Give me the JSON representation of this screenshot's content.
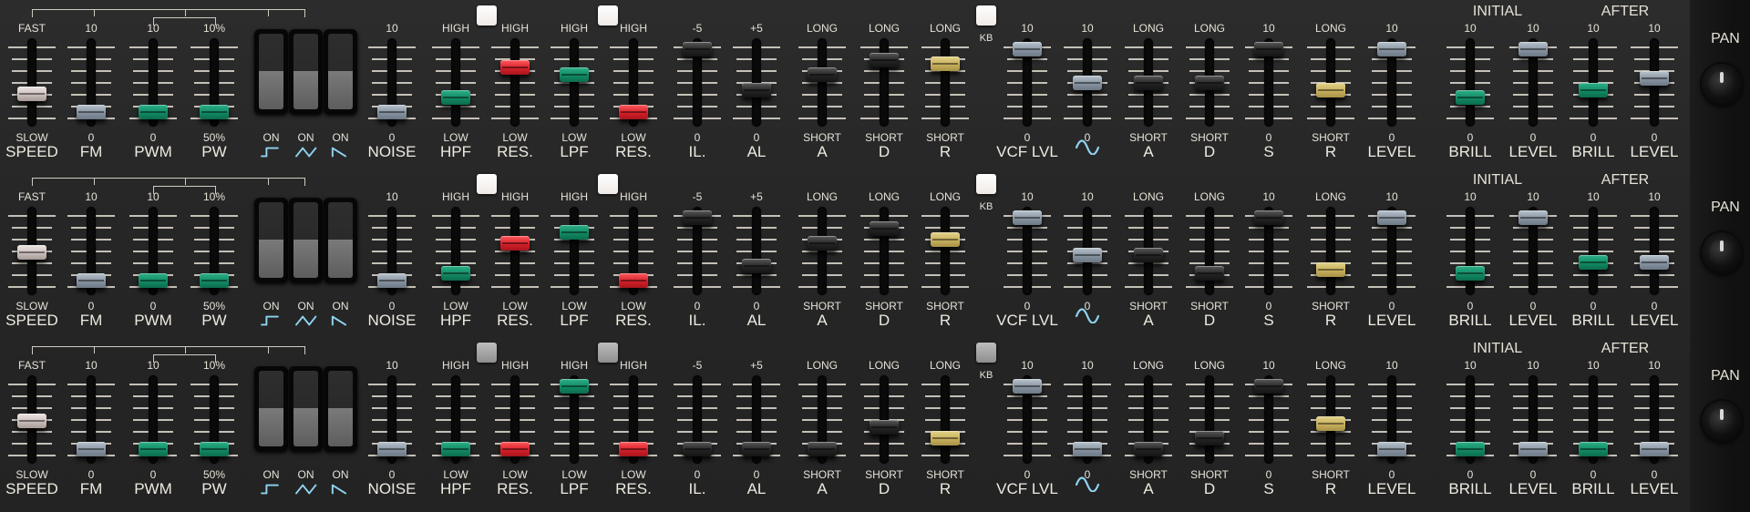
{
  "pan_label": "PAN",
  "headers": {
    "initial": "INITIAL",
    "after": "AFTER",
    "kb": "KB"
  },
  "rockers": [
    {
      "label": "ON",
      "waveform": "square-wave-icon"
    },
    {
      "label": "ON",
      "waveform": "triangle-wave-icon"
    },
    {
      "label": "ON",
      "waveform": "sawtooth-wave-icon"
    }
  ],
  "channel_defs": [
    {
      "key": "speed",
      "name": "SPEED",
      "top": "FAST",
      "bottom": "SLOW",
      "color": "cream"
    },
    {
      "key": "fm",
      "name": "FM",
      "top": "10",
      "bottom": "0",
      "color": "grey"
    },
    {
      "key": "pwm",
      "name": "PWM",
      "top": "10",
      "bottom": "0",
      "color": "green"
    },
    {
      "key": "pw",
      "name": "PW",
      "top": "10%",
      "bottom": "50%",
      "color": "green"
    },
    {
      "key": "noise",
      "name": "NOISE",
      "top": "10",
      "bottom": "0",
      "color": "grey"
    },
    {
      "key": "hpf",
      "name": "HPF",
      "top": "HIGH",
      "bottom": "LOW",
      "color": "green"
    },
    {
      "key": "hpf_res",
      "name": "RES.",
      "top": "HIGH",
      "bottom": "LOW",
      "color": "red"
    },
    {
      "key": "lpf",
      "name": "LPF",
      "top": "HIGH",
      "bottom": "LOW",
      "color": "green"
    },
    {
      "key": "lpf_res",
      "name": "RES.",
      "top": "HIGH",
      "bottom": "LOW",
      "color": "red"
    },
    {
      "key": "il",
      "name": "IL.",
      "top": "-5",
      "bottom": "0",
      "color": "black"
    },
    {
      "key": "al",
      "name": "AL",
      "top": "+5",
      "bottom": "0",
      "color": "black"
    },
    {
      "key": "a1",
      "name": "A",
      "top": "LONG",
      "bottom": "SHORT",
      "color": "black"
    },
    {
      "key": "d1",
      "name": "D",
      "top": "LONG",
      "bottom": "SHORT",
      "color": "black"
    },
    {
      "key": "r1",
      "name": "R",
      "top": "LONG",
      "bottom": "SHORT",
      "color": "yellow"
    },
    {
      "key": "vcf_lvl",
      "name": "VCF LVL",
      "top": "10",
      "bottom": "0",
      "color": "grey"
    },
    {
      "key": "lfo",
      "name": "",
      "top": "10",
      "bottom": "0",
      "color": "grey",
      "icon": "sine-wave-icon"
    },
    {
      "key": "a2",
      "name": "A",
      "top": "LONG",
      "bottom": "SHORT",
      "color": "black"
    },
    {
      "key": "d2",
      "name": "D",
      "top": "LONG",
      "bottom": "SHORT",
      "color": "black"
    },
    {
      "key": "s2",
      "name": "S",
      "top": "10",
      "bottom": "0",
      "color": "black"
    },
    {
      "key": "r2",
      "name": "R",
      "top": "LONG",
      "bottom": "SHORT",
      "color": "yellow"
    },
    {
      "key": "level",
      "name": "LEVEL",
      "top": "10",
      "bottom": "0",
      "color": "grey"
    },
    {
      "key": "init_brill",
      "name": "BRILL",
      "top": "10",
      "bottom": "0",
      "color": "green"
    },
    {
      "key": "init_level",
      "name": "LEVEL",
      "top": "10",
      "bottom": "0",
      "color": "grey"
    },
    {
      "key": "after_brill",
      "name": "BRILL",
      "top": "10",
      "bottom": "0",
      "color": "green"
    },
    {
      "key": "after_level",
      "name": "LEVEL",
      "top": "10",
      "bottom": "0",
      "color": "grey"
    }
  ],
  "rows": [
    {
      "buttons": {
        "hpf": "on",
        "lpf": "on",
        "kb": "on"
      },
      "values": [
        0.35,
        0.1,
        0.1,
        0.1,
        0.1,
        0.3,
        0.7,
        0.6,
        0.1,
        0.95,
        0.4,
        0.6,
        0.8,
        0.75,
        0.95,
        0.5,
        0.5,
        0.5,
        0.95,
        0.4,
        0.95,
        0.3,
        0.95,
        0.4,
        0.55
      ]
    },
    {
      "buttons": {
        "hpf": "on",
        "lpf": "on",
        "kb": "on"
      },
      "values": [
        0.48,
        0.1,
        0.1,
        0.1,
        0.1,
        0.2,
        0.6,
        0.75,
        0.1,
        0.95,
        0.3,
        0.6,
        0.8,
        0.65,
        0.95,
        0.45,
        0.45,
        0.2,
        0.95,
        0.25,
        0.95,
        0.2,
        0.95,
        0.35,
        0.35
      ]
    },
    {
      "buttons": {
        "hpf": "off",
        "lpf": "off",
        "kb": "off"
      },
      "values": [
        0.48,
        0.1,
        0.1,
        0.1,
        0.1,
        0.1,
        0.1,
        0.95,
        0.1,
        0.1,
        0.1,
        0.1,
        0.4,
        0.25,
        0.95,
        0.1,
        0.1,
        0.25,
        0.95,
        0.45,
        0.1,
        0.1,
        0.1,
        0.1,
        0.1
      ]
    }
  ]
}
